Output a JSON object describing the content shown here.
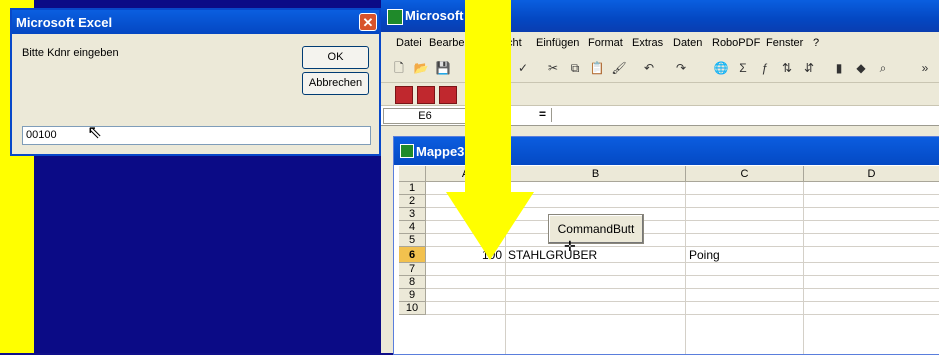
{
  "dialog": {
    "title": "Microsoft Excel",
    "prompt": "Bitte Kdnr eingeben",
    "ok_label": "OK",
    "cancel_label": "Abbrechen",
    "input_value": "00100",
    "close_glyph": "✕"
  },
  "excel": {
    "title": "Microsoft",
    "menu": [
      "Datei",
      "Bearbei",
      "cht",
      "Einfügen",
      "Format",
      "Extras",
      "Daten",
      "RoboPDF",
      "Fenster",
      "?"
    ],
    "namebox": "E6",
    "formula_equals": "="
  },
  "workbook": {
    "title": "Mappe3",
    "columns": [
      "A",
      "B",
      "C",
      "D"
    ],
    "rows": [
      "1",
      "2",
      "3",
      "4",
      "5",
      "6",
      "7",
      "8",
      "9",
      "10"
    ],
    "cells": {
      "a6": "100",
      "b6": "STAHLGRUBER",
      "c6": "Poing"
    },
    "command_button": "CommandButt"
  },
  "icons": {
    "toolbar": [
      "new-icon",
      "open-icon",
      "save-icon",
      "spell-check-icon",
      "cut-icon",
      "copy-icon",
      "paste-icon",
      "format-painter-icon",
      "undo-icon",
      "redo-icon",
      "hyperlink-icon",
      "autosum-icon",
      "function-icon",
      "sort-asc-icon",
      "sort-desc-icon",
      "chart-icon",
      "drawing-icon",
      "zoom-icon"
    ]
  },
  "colors": {
    "highlight_arrow": "#ffff00",
    "xp_titlebar": "#0447c2",
    "selected_header": "#f2c14e"
  }
}
